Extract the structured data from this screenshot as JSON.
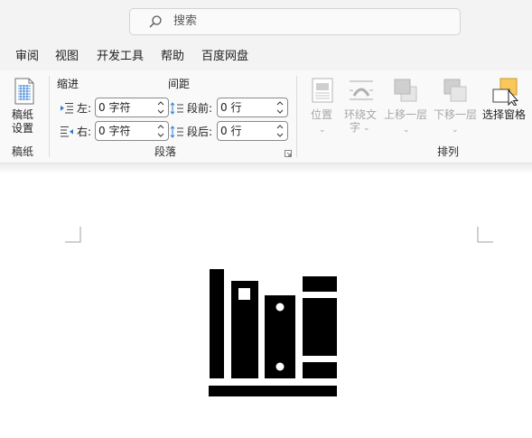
{
  "search": {
    "label": "搜索"
  },
  "tabs": [
    "审阅",
    "视图",
    "开发工具",
    "帮助",
    "百度网盘"
  ],
  "ribbon": {
    "manuscript": {
      "button_line1": "稿纸",
      "button_line2": "设置",
      "group_label": "稿纸"
    },
    "paragraph": {
      "indent_heading": "缩进",
      "spacing_heading": "间距",
      "left_label": "左:",
      "left_value": "0 字符",
      "right_label": "右:",
      "right_value": "0 字符",
      "before_label": "段前:",
      "before_value": "0 行",
      "after_label": "段后:",
      "after_value": "0 行",
      "group_label": "段落"
    },
    "arrange": {
      "position_label": "位置",
      "wrap_line1": "环绕文",
      "wrap_line2": "字",
      "bring_forward_label": "上移一层",
      "send_backward_label": "下移一层",
      "selection_pane_label": "选择窗格",
      "group_label": "排列"
    }
  },
  "colors": {
    "accent": "#2b7cd3",
    "selection_pane_icon": "#f9c85a",
    "ribbon_bg": "#f9f9f9",
    "chrome_bg": "#f3f3f3"
  },
  "icons": [
    "search-icon",
    "manuscript-icon",
    "indent-left-icon",
    "indent-right-icon",
    "spacing-before-icon",
    "spacing-after-icon",
    "position-icon",
    "wrap-text-icon",
    "bring-forward-icon",
    "send-backward-icon",
    "selection-pane-icon",
    "dialog-launcher-icon",
    "bookshelf-icon"
  ]
}
